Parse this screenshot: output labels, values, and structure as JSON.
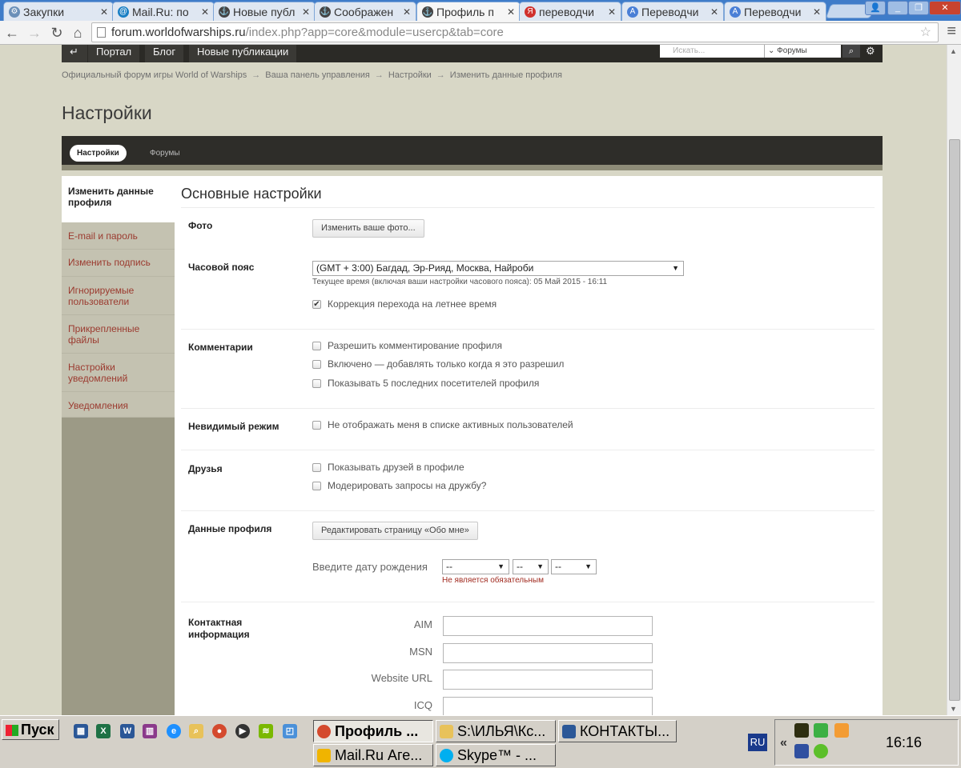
{
  "browser": {
    "tabs": [
      {
        "label": "Закупки",
        "icon": "gear-icon",
        "color": "#6a8fb8"
      },
      {
        "label": "Mail.Ru: по",
        "icon": "mail-ru-icon",
        "color": "#1a7fc4"
      },
      {
        "label": "Новые публ",
        "icon": "wows-icon",
        "color": "#444444"
      },
      {
        "label": "Соображен",
        "icon": "wows-icon",
        "color": "#444444"
      },
      {
        "label": "Профиль п",
        "icon": "wows-icon",
        "color": "#444444"
      },
      {
        "label": "переводчи",
        "icon": "yandex-icon",
        "color": "#d0312d"
      },
      {
        "label": "Переводчи",
        "icon": "translate-icon",
        "color": "#4a7fd6"
      },
      {
        "label": "Переводчи",
        "icon": "translate-icon",
        "color": "#4a7fd6"
      }
    ],
    "url_host": "forum.worldofwarships.ru",
    "url_path": "/index.php?app=core&module=usercp&tab=core"
  },
  "site_nav": {
    "items": [
      "Портал",
      "Блог",
      "Новые публикации"
    ],
    "search_placeholder": "Искать...",
    "search_scope": "Форумы"
  },
  "breadcrumb": [
    "Официальный форум игры World of Warships",
    "Ваша панель управления",
    "Настройки",
    "Изменить данные профиля"
  ],
  "page_title": "Настройки",
  "usercp_tabs": [
    "Настройки",
    "Форумы"
  ],
  "sidebar": [
    "Изменить данные профиля",
    "E-mail и пароль",
    "Изменить подпись",
    "Игнорируемые пользователи",
    "Прикрепленные файлы",
    "Настройки уведомлений",
    "Уведомления"
  ],
  "main": {
    "section_title": "Основные настройки",
    "photo": {
      "label": "Фото",
      "button": "Изменить ваше фото..."
    },
    "timezone": {
      "label": "Часовой пояс",
      "value": "(GMT + 3:00) Багдад, Эр-Рияд, Москва, Найроби",
      "hint": "Текущее время (включая ваши настройки часового пояса): 05 Май 2015 - 16:11",
      "dst_label": "Коррекция перехода на летнее время",
      "dst_checked": true
    },
    "comments": {
      "label": "Комментарии",
      "options": [
        {
          "label": "Разрешить комментирование профиля",
          "checked": false
        },
        {
          "label": "Включено — добавлять только когда я это разрешил",
          "checked": false
        },
        {
          "label": "Показывать 5 последних посетителей профиля",
          "checked": false
        }
      ]
    },
    "invisible": {
      "label": "Невидимый режим",
      "option": "Не отображать меня в списке активных пользователей",
      "checked": false
    },
    "friends": {
      "label": "Друзья",
      "options": [
        {
          "label": "Показывать друзей в профиле",
          "checked": false
        },
        {
          "label": "Модерировать запросы на дружбу?",
          "checked": false
        }
      ]
    },
    "profile_data": {
      "label": "Данные профиля",
      "button": "Редактировать страницу «Обо мне»",
      "birthday_label": "Введите дату рождения",
      "birthday_month": "--",
      "birthday_day": "--",
      "birthday_year": "--",
      "birthday_note": "Не является обязательным"
    },
    "contacts": {
      "label": "Контактная информация",
      "fields": [
        "AIM",
        "MSN",
        "Website URL",
        "ICQ"
      ]
    }
  },
  "taskbar": {
    "start": "Пуск",
    "tasks": [
      {
        "label": "Профиль ...",
        "active": true,
        "color": "#d44a2e"
      },
      {
        "label": "S:\\ИЛЬЯ\\Кс...",
        "active": false,
        "color": "#e8c25a"
      },
      {
        "label": "КОНТАКТЫ...",
        "active": false,
        "color": "#2b5797"
      },
      {
        "label": "Mail.Ru Аге...",
        "active": false,
        "color": "#f0b400"
      },
      {
        "label": "Skype™ - ...",
        "active": false,
        "color": "#00aff0"
      }
    ],
    "lang": "RU",
    "clock": "16:16"
  }
}
